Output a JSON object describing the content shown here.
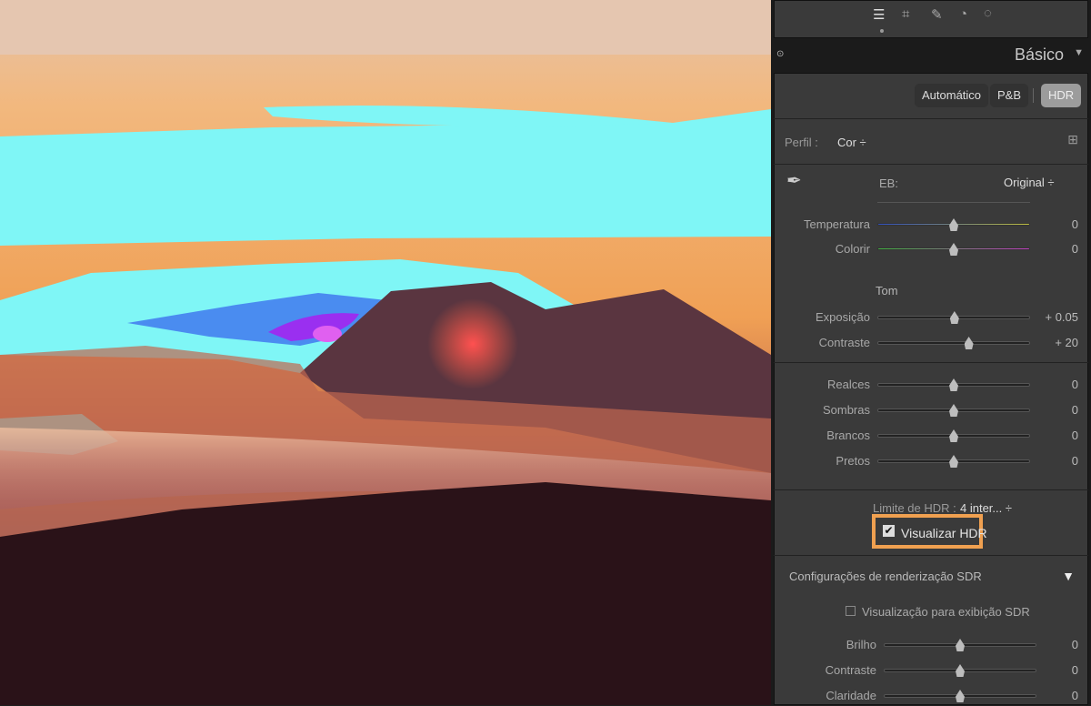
{
  "toolbar": {
    "icons": [
      "sliders-icon",
      "crop-icon",
      "healing-icon",
      "red-eye-icon",
      "mask-icon"
    ]
  },
  "panel": {
    "title": "Básico",
    "treatment": {
      "auto": "Automático",
      "bw": "P&B",
      "hdr": "HDR"
    },
    "profile": {
      "label": "Perfil :",
      "value": "Cor ÷"
    },
    "wb": {
      "label": "EB:",
      "value": "Original ÷"
    },
    "temp": {
      "label": "Temperatura",
      "value": "0",
      "fraction": 0.5
    },
    "tint": {
      "label": "Colorir",
      "value": "0",
      "fraction": 0.5
    },
    "tone_title": "Tom",
    "exposure": {
      "label": "Exposição",
      "value": "+ 0.05",
      "fraction": 0.505
    },
    "contrast": {
      "label": "Contraste",
      "value": "+ 20",
      "fraction": 0.6
    },
    "highlights": {
      "label": "Realces",
      "value": "0",
      "fraction": 0.5
    },
    "shadows": {
      "label": "Sombras",
      "value": "0",
      "fraction": 0.5
    },
    "whites": {
      "label": "Brancos",
      "value": "0",
      "fraction": 0.5
    },
    "blacks": {
      "label": "Pretos",
      "value": "0",
      "fraction": 0.5
    },
    "hdr_limit": {
      "label": "Limite de HDR :",
      "value": "4 inter... ÷"
    },
    "visualize_hdr": {
      "label": "Visualizar HDR",
      "checked": true
    },
    "sdr": {
      "title": "Configurações de renderização SDR",
      "preview_label": "Visualização para exibição SDR",
      "brightness": {
        "label": "Brilho",
        "value": "0",
        "fraction": 0.5
      },
      "contrast": {
        "label": "Contraste",
        "value": "0",
        "fraction": 0.5
      },
      "clarity": {
        "label": "Claridade",
        "value": "0",
        "fraction": 0.5
      }
    }
  },
  "colors": {
    "highlight": "#f0a050",
    "accent": "#7fa9d6"
  }
}
